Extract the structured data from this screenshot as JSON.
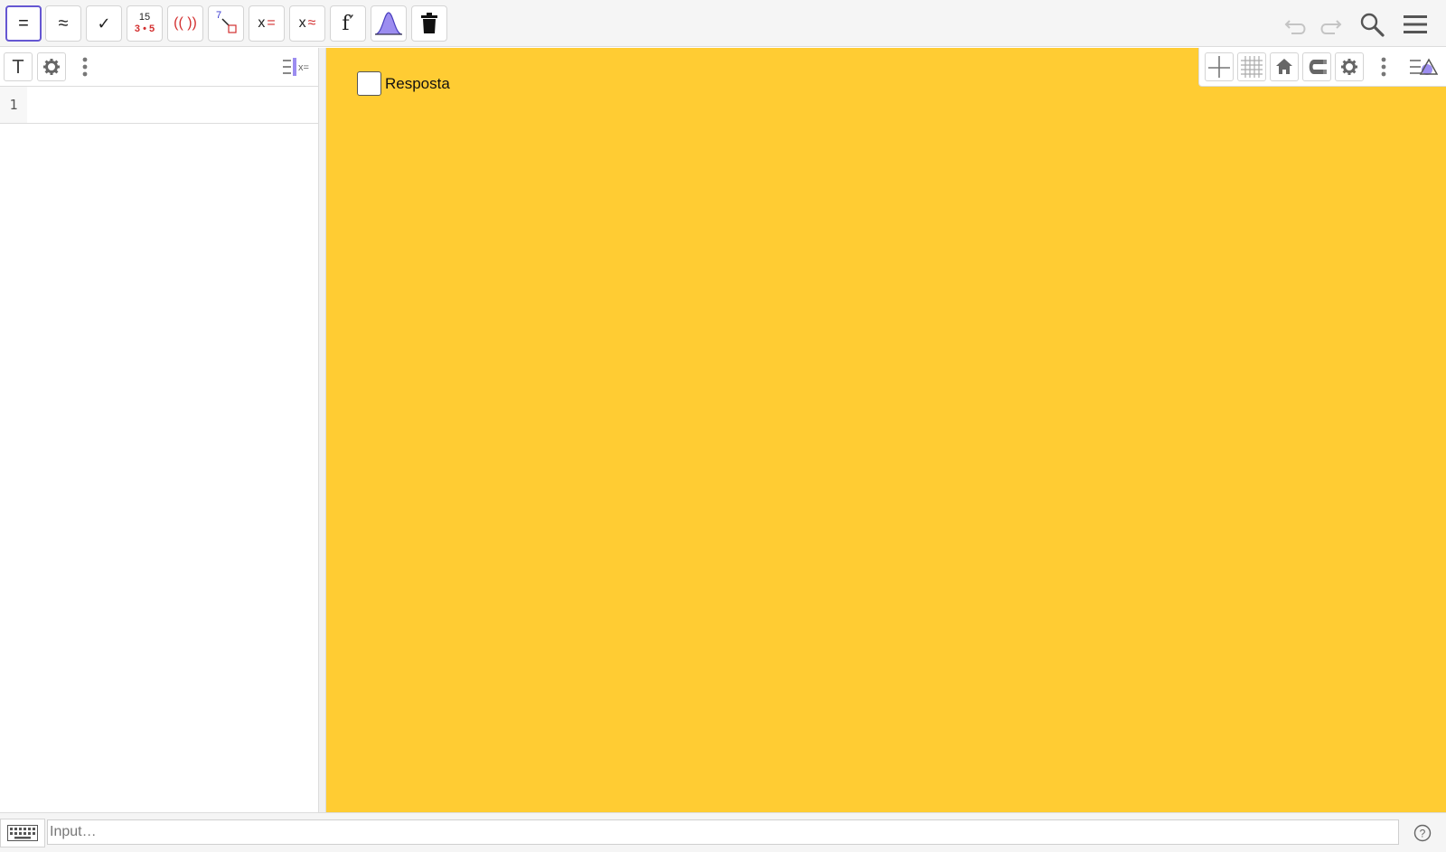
{
  "toolbar": {
    "tools": [
      {
        "name": "evaluate",
        "glyph": "="
      },
      {
        "name": "numeric",
        "glyph": "≈"
      },
      {
        "name": "keep-input",
        "glyph": "✓"
      },
      {
        "name": "factor",
        "top": "15",
        "bottom": "3 • 5"
      },
      {
        "name": "expand",
        "glyph": "(( ))"
      },
      {
        "name": "substitute",
        "top": "7"
      },
      {
        "name": "solve",
        "x": "x",
        "op": "="
      },
      {
        "name": "solve-numerically",
        "x": "x",
        "op": "≈"
      },
      {
        "name": "derivative",
        "glyph": "f′"
      },
      {
        "name": "probability-calculator"
      },
      {
        "name": "delete"
      }
    ],
    "right": [
      "undo",
      "redo",
      "search",
      "menu"
    ],
    "icon_color": "#333333",
    "active_color": "#6557d2"
  },
  "algebra": {
    "header_buttons": [
      "T",
      "settings",
      "more"
    ],
    "rows": [
      {
        "number": "1",
        "value": ""
      }
    ]
  },
  "graphics": {
    "background_color": "#ffcc33",
    "checkbox": {
      "label": "Resposta",
      "checked": false
    }
  },
  "input_bar": {
    "placeholder": "Input…",
    "value": ""
  }
}
